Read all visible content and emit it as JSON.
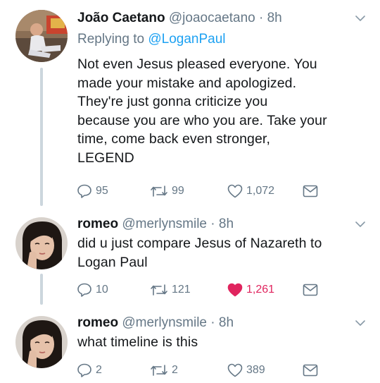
{
  "tweets": [
    {
      "display_name": "João Caetano",
      "handle": "@joaocaetano",
      "separator": "·",
      "time": "8h",
      "replying_prefix": "Replying to",
      "replying_to": "@LoganPaul",
      "text_lines": [
        "Not even Jesus pleased everyone. You",
        "made your mistake and apologized.",
        "They're just gonna criticize you",
        "because you are who you are. Take your",
        "time, come back even stronger,",
        "LEGEND"
      ],
      "replies": "95",
      "retweets": "99",
      "likes": "1,072",
      "liked": false,
      "avatar_icon": "profile-photo-man-sitting"
    },
    {
      "display_name": "romeo",
      "handle": "@merlynsmile",
      "separator": "·",
      "time": "8h",
      "text_lines": [
        "did u just compare Jesus of Nazareth to",
        "Logan Paul"
      ],
      "replies": "10",
      "retweets": "121",
      "likes": "1,261",
      "liked": true,
      "avatar_icon": "profile-photo-woman-hand-on-cheek"
    },
    {
      "display_name": "romeo",
      "handle": "@merlynsmile",
      "separator": "·",
      "time": "8h",
      "text_lines": [
        "what timeline is this"
      ],
      "replies": "2",
      "retweets": "2",
      "likes": "389",
      "liked": false,
      "avatar_icon": "profile-photo-woman-hand-on-cheek"
    }
  ],
  "colors": {
    "text": "#14171a",
    "muted": "#657786",
    "link": "#1da1f2",
    "like": "#e0245e",
    "thread_line": "#ccd6dd"
  }
}
